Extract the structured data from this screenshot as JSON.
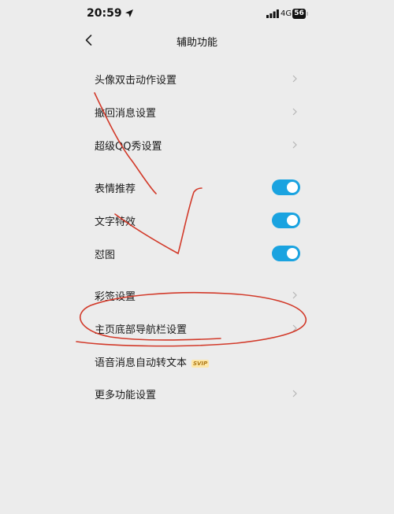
{
  "status_bar": {
    "time": "20:59",
    "network": "4G",
    "battery": "56",
    "location_icon": "location-arrow-icon",
    "signal_icon": "cellular-signal-icon",
    "battery_icon": "battery-icon"
  },
  "header": {
    "title": "辅助功能",
    "back_icon": "chevron-left-icon"
  },
  "group1": {
    "items": [
      {
        "label": "头像双击动作设置"
      },
      {
        "label": "撤回消息设置"
      },
      {
        "label": "超级QQ秀设置"
      }
    ]
  },
  "group2": {
    "items": [
      {
        "label": "表情推荐",
        "enabled": true
      },
      {
        "label": "文字特效",
        "enabled": true
      },
      {
        "label": "怼图",
        "enabled": true
      }
    ]
  },
  "group3": {
    "items": [
      {
        "label": "彩签设置"
      },
      {
        "label": "主页底部导航栏设置"
      },
      {
        "label": "语音消息自动转文本",
        "badge": "SVIP"
      },
      {
        "label": "更多功能设置"
      }
    ]
  },
  "colors": {
    "toggle_on": "#1aa3e0",
    "annotation": "#d23a2a",
    "background": "#ececec"
  }
}
